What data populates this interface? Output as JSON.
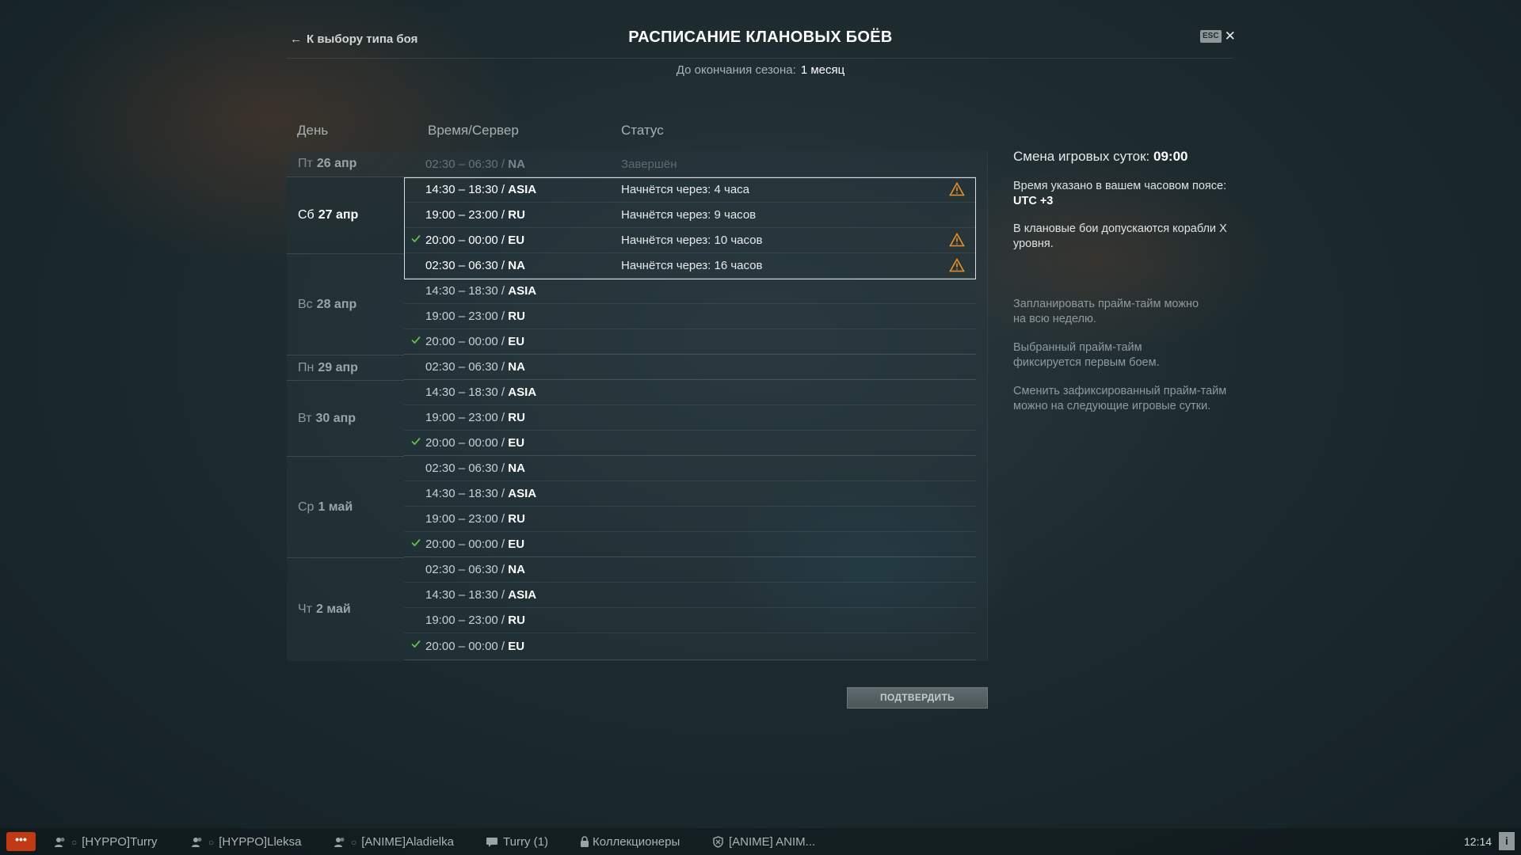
{
  "header": {
    "back_label": "К выбору типа боя",
    "title": "РАСПИСАНИЕ КЛАНОВЫХ БОЁВ",
    "esc_label": "ESC",
    "close_glyph": "✕",
    "season_label": "До окончания сезона:",
    "season_value": "1 месяц"
  },
  "table": {
    "columns": {
      "day": "День",
      "time_server": "Время/Сервер",
      "status": "Статус"
    },
    "days": [
      {
        "dow": "Пт",
        "date": "26 апр"
      },
      {
        "dow": "Сб",
        "date": "27 апр"
      },
      {
        "dow": "Вс",
        "date": "28 апр"
      },
      {
        "dow": "Пн",
        "date": "29 апр"
      },
      {
        "dow": "Вт",
        "date": "30 апр"
      },
      {
        "dow": "Ср",
        "date": "1 май"
      },
      {
        "dow": "Чт",
        "date": "2 май"
      }
    ],
    "slots": [
      {
        "time": "02:30 – 06:30 /",
        "server": "NA",
        "status": "Завершён",
        "state": "past",
        "checked": false,
        "warning": false
      },
      {
        "time": "14:30 – 18:30 /",
        "server": "ASIA",
        "status": "Начнётся через: 4 часа",
        "state": "highlight",
        "checked": false,
        "warning": true
      },
      {
        "time": "19:00 – 23:00 /",
        "server": "RU",
        "status": "Начнётся через: 9 часов",
        "state": "highlight",
        "checked": false,
        "warning": false
      },
      {
        "time": "20:00 – 00:00 /",
        "server": "EU",
        "status": "Начнётся через: 10 часов",
        "state": "highlight",
        "checked": true,
        "warning": true
      },
      {
        "time": "02:30 – 06:30 /",
        "server": "NA",
        "status": "Начнётся через: 16 часов",
        "state": "highlight",
        "checked": false,
        "warning": true
      },
      {
        "time": "14:30 – 18:30 /",
        "server": "ASIA",
        "status": "",
        "state": "normal",
        "checked": false,
        "warning": false
      },
      {
        "time": "19:00 – 23:00 /",
        "server": "RU",
        "status": "",
        "state": "normal",
        "checked": false,
        "warning": false
      },
      {
        "time": "20:00 – 00:00 /",
        "server": "EU",
        "status": "",
        "state": "normal",
        "checked": true,
        "warning": false
      },
      {
        "time": "02:30 – 06:30 /",
        "server": "NA",
        "status": "",
        "state": "normal",
        "checked": false,
        "warning": false
      },
      {
        "time": "14:30 – 18:30 /",
        "server": "ASIA",
        "status": "",
        "state": "normal",
        "checked": false,
        "warning": false
      },
      {
        "time": "19:00 – 23:00 /",
        "server": "RU",
        "status": "",
        "state": "normal",
        "checked": false,
        "warning": false
      },
      {
        "time": "20:00 – 00:00 /",
        "server": "EU",
        "status": "",
        "state": "normal",
        "checked": true,
        "warning": false
      },
      {
        "time": "02:30 – 06:30 /",
        "server": "NA",
        "status": "",
        "state": "normal",
        "checked": false,
        "warning": false
      },
      {
        "time": "14:30 – 18:30 /",
        "server": "ASIA",
        "status": "",
        "state": "normal",
        "checked": false,
        "warning": false
      },
      {
        "time": "19:00 – 23:00 /",
        "server": "RU",
        "status": "",
        "state": "normal",
        "checked": false,
        "warning": false
      },
      {
        "time": "20:00 – 00:00 /",
        "server": "EU",
        "status": "",
        "state": "normal",
        "checked": true,
        "warning": false
      },
      {
        "time": "02:30 – 06:30 /",
        "server": "NA",
        "status": "",
        "state": "normal",
        "checked": false,
        "warning": false
      },
      {
        "time": "14:30 – 18:30 /",
        "server": "ASIA",
        "status": "",
        "state": "normal",
        "checked": false,
        "warning": false
      },
      {
        "time": "19:00 – 23:00 /",
        "server": "RU",
        "status": "",
        "state": "normal",
        "checked": false,
        "warning": false
      },
      {
        "time": "20:00 – 00:00 /",
        "server": "EU",
        "status": "",
        "state": "normal",
        "checked": true,
        "warning": false
      }
    ]
  },
  "info": {
    "day_change_label": "Смена игровых суток:",
    "day_change_value": "09:00",
    "timezone_text": "Время указано в вашем часовом поясе:",
    "timezone_value": "UTC +3",
    "ships_text": "В клановые бои допускаются корабли X уровня.",
    "note1": "Запланировать прайм-тайм можно на всю неделю.",
    "note2": "Выбранный прайм-тайм фиксируется первым боем.",
    "note3": "Сменить зафиксированный прайм-тайм можно на следующие игровые сутки."
  },
  "confirm_label": "ПОДТВЕРДИТЬ",
  "bottom": {
    "chat_glyph": "•••",
    "items": [
      {
        "label": "[HYPPO]Turry",
        "icon": "divison-user-icon"
      },
      {
        "label": "[HYPPO]Lleksa",
        "icon": "divison-user-icon"
      },
      {
        "label": "[ANIME]Aladielka",
        "icon": "divison-user-icon"
      },
      {
        "label": "Turry (1)",
        "icon": "message-icon"
      },
      {
        "label": "Коллекционеры",
        "icon": "lock-icon"
      },
      {
        "label": "[ANIME] ANIM...",
        "icon": "clan-icon"
      }
    ],
    "clock": "12:14",
    "info_glyph": "i"
  },
  "colors": {
    "accent_warning": "#e8902a",
    "check": "#5fbf4a",
    "chat_button": "#c23a14"
  }
}
